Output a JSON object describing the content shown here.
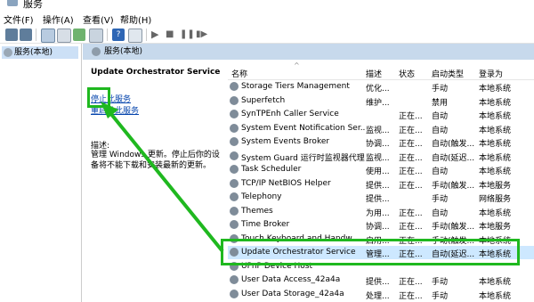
{
  "window": {
    "title": "服务"
  },
  "menu": [
    "文件(F)",
    "操作(A)",
    "查看(V)",
    "帮助(H)"
  ],
  "left_pane": {
    "item": "服务(本地)"
  },
  "main_header": {
    "label": "服务(本地)"
  },
  "detail": {
    "service_title": "Update Orchestrator Service",
    "stop_link": "停止此服务",
    "restart_link": "重启动此服务",
    "desc_label": "描述:",
    "description": "管理 Windows 更新。停止后你的设备将不能下载和安装最新的更新。"
  },
  "table": {
    "columns": {
      "name": "名称",
      "desc": "描述",
      "state": "状态",
      "startup": "启动类型",
      "logon": "登录为"
    },
    "rows": [
      {
        "name": "Storage Tiers Management",
        "desc": "优化...",
        "state": "",
        "startup": "手动",
        "logon": "本地系统"
      },
      {
        "name": "Superfetch",
        "desc": "维护...",
        "state": "",
        "startup": "禁用",
        "logon": "本地系统"
      },
      {
        "name": "SynTPEnh Caller Service",
        "desc": "",
        "state": "正在...",
        "startup": "自动",
        "logon": "本地系统"
      },
      {
        "name": "System Event Notification Ser...",
        "desc": "监视...",
        "state": "正在...",
        "startup": "自动",
        "logon": "本地系统"
      },
      {
        "name": "System Events Broker",
        "desc": "协调...",
        "state": "正在...",
        "startup": "自动(触发...",
        "logon": "本地系统"
      },
      {
        "name": "System Guard 运行时监视器代理",
        "desc": "监视...",
        "state": "正在...",
        "startup": "自动(延迟...",
        "logon": "本地系统"
      },
      {
        "name": "Task Scheduler",
        "desc": "使用...",
        "state": "正在...",
        "startup": "自动",
        "logon": "本地系统"
      },
      {
        "name": "TCP/IP NetBIOS Helper",
        "desc": "提供...",
        "state": "正在...",
        "startup": "手动(触发...",
        "logon": "本地服务"
      },
      {
        "name": "Telephony",
        "desc": "提供...",
        "state": "",
        "startup": "手动",
        "logon": "网络服务"
      },
      {
        "name": "Themes",
        "desc": "为用...",
        "state": "正在...",
        "startup": "自动",
        "logon": "本地系统"
      },
      {
        "name": "Time Broker",
        "desc": "协调...",
        "state": "正在...",
        "startup": "手动(触发...",
        "logon": "本地服务"
      },
      {
        "name": "Touch Keyboard and Handw...",
        "desc": "启用...",
        "state": "正在...",
        "startup": "手动(触发...",
        "logon": "本地系统"
      },
      {
        "name": "Update Orchestrator Service",
        "desc": "管理...",
        "state": "正在...",
        "startup": "自动(延迟...",
        "logon": "本地系统"
      },
      {
        "name": "UPnP Device Host",
        "desc": "",
        "state": "",
        "startup": "",
        "logon": ""
      },
      {
        "name": "User Data Access_42a4a",
        "desc": "提供...",
        "state": "正在...",
        "startup": "手动",
        "logon": "本地系统"
      },
      {
        "name": "User Data Storage_42a4a",
        "desc": "处理...",
        "state": "正在...",
        "startup": "手动",
        "logon": "本地系统"
      }
    ]
  },
  "colors": {
    "highlight": "#1fb81f",
    "selection": "#cde8ff",
    "header_band": "#c7d9ec"
  }
}
